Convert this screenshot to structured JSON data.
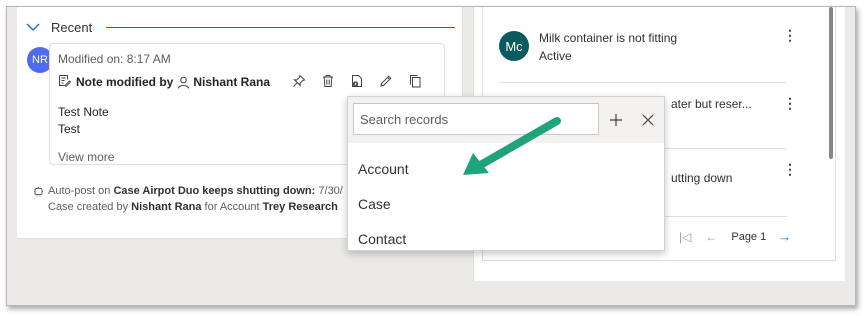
{
  "recent": {
    "label": "Recent"
  },
  "note": {
    "avatar_initials": "NR",
    "modified_on": "Modified on: 8:17 AM",
    "title_prefix": "Note modified by",
    "author": "Nishant Rana",
    "body_line1": "Test Note",
    "body_line2": "Test",
    "view_more": "View more"
  },
  "autopost": {
    "prefix": "Auto-post on",
    "subject": "Case Airpot Duo keeps shutting down:",
    "date": "7/30/",
    "line2_prefix": "Case created by",
    "creator": "Nishant Rana",
    "line2_mid": "for Account",
    "account": "Trey Research"
  },
  "list": {
    "items": [
      {
        "avatar_initials": "Mc",
        "title": "Milk container is not fitting",
        "status": "Active"
      },
      {
        "title": "ater but reser...",
        "status": ""
      },
      {
        "title": "utting down",
        "status": ""
      }
    ],
    "page_label": "Page 1"
  },
  "lookup": {
    "search_placeholder": "Search records",
    "options": [
      "Account",
      "Case",
      "Contact"
    ]
  },
  "colors": {
    "accent": "#0f6cbd",
    "avatar_nr": "#4f6bed",
    "avatar_mc": "#0b5a5e",
    "annotation_arrow": "#1fa37a"
  }
}
